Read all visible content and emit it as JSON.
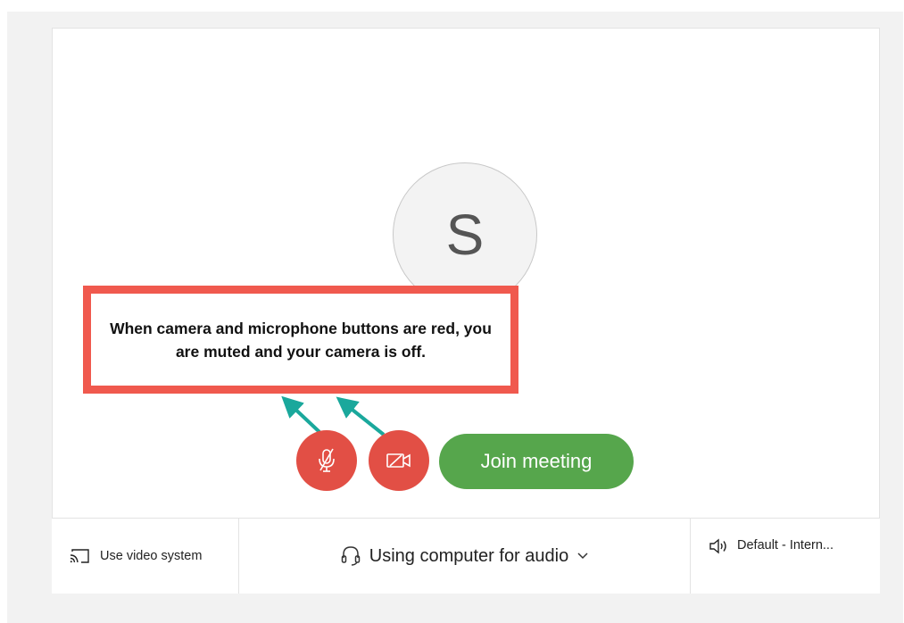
{
  "avatar": {
    "initial": "S"
  },
  "callout": {
    "text": "When camera and microphone buttons are red, you are muted and your camera is off."
  },
  "controls": {
    "mic_icon": "microphone-muted-icon",
    "camera_icon": "camera-off-icon",
    "join_label": "Join meeting",
    "button_color": "#e24f45",
    "join_color": "#56a64c"
  },
  "bottom_bar": {
    "video_system_label": "Use video system",
    "audio_label": "Using computer for audio",
    "speaker_label": "Default - Intern..."
  },
  "annotation": {
    "callout_border_color": "#f0594e",
    "arrow_color": "#1aa89c"
  }
}
